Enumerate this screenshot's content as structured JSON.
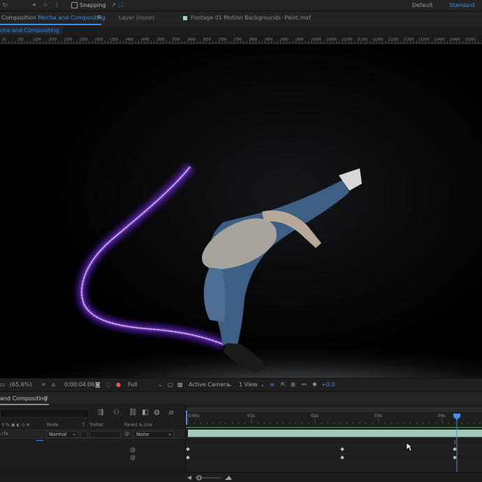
{
  "toolbar": {
    "snapping_label": "Snapping",
    "workspace_default": "Default",
    "workspace_standard": "Standard"
  },
  "tabs": {
    "composition_prefix": "Composition",
    "composition_name": "Mocha and Compositing",
    "menu_glyph": "≡",
    "layer_tab": "Layer (none)",
    "footage_tab": "Footage 01 Motion Backgrounds -Paint.mxf"
  },
  "breadcrumb": "cha and Compositing",
  "ruler": {
    "labels": [
      "0",
      "50",
      "100",
      "150",
      "200",
      "250",
      "300",
      "350",
      "400",
      "450",
      "500",
      "550",
      "600",
      "650",
      "700",
      "750",
      "800",
      "850",
      "900",
      "950",
      "1000",
      "1050",
      "1100",
      "1150",
      "1200",
      "1250",
      "1300",
      "1350",
      "1400",
      "1450",
      "1500"
    ]
  },
  "viewer_controls": {
    "zoom": "(65.6%)",
    "timecode": "0:00:04:06",
    "resolution": "Full",
    "camera": "Active Camera",
    "views": "1 View",
    "exposure": "+0.0"
  },
  "timeline": {
    "tab_label": "and Compositing",
    "menu_glyph": "≡",
    "columns": {
      "mode": "Mode",
      "t": "T",
      "trkmat": "TrkMat",
      "parent": "Parent & Link"
    },
    "layer": {
      "mode": "Normal",
      "parent": "None"
    },
    "time_labels": [
      "0:00s",
      "01s",
      "02s",
      "03s",
      "04s"
    ],
    "spiral_glyph": "@"
  },
  "colors": {
    "accent": "#3f8fe6",
    "track_bar": "#9fcbb8",
    "track_line": "#2e8b3a",
    "glow": "#9b3cff"
  }
}
